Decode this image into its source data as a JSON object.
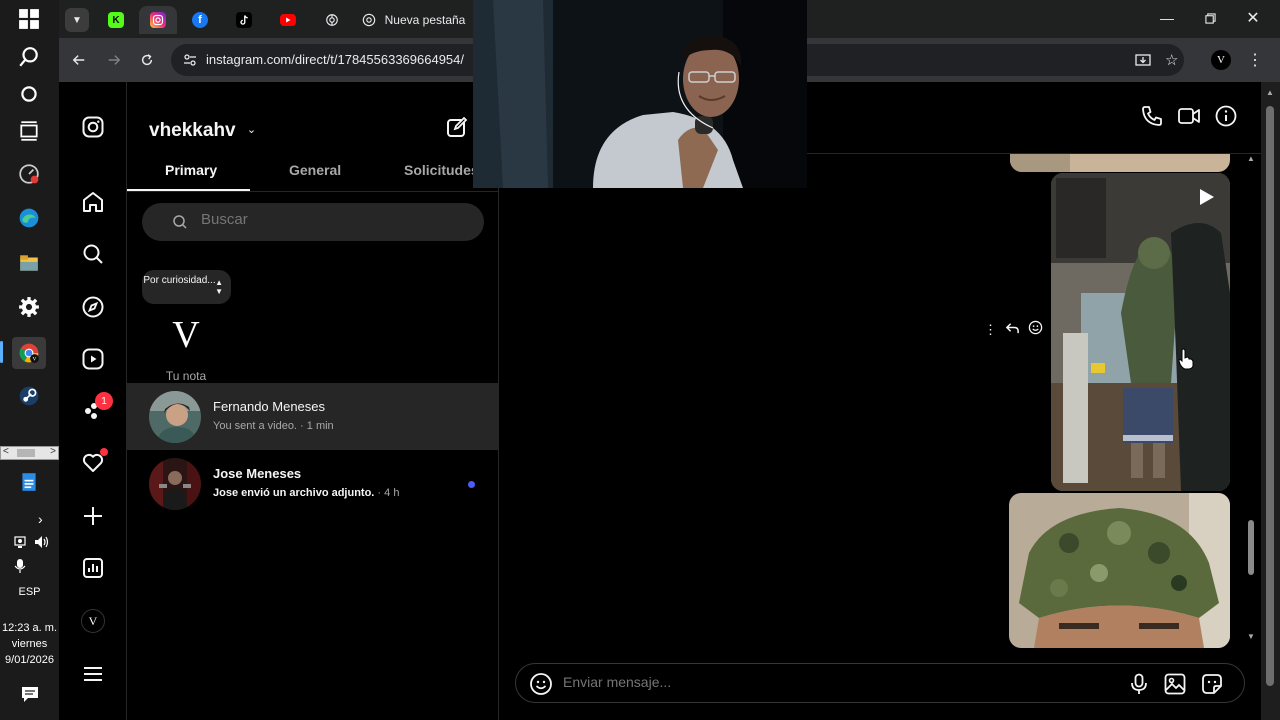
{
  "taskbar": {
    "time": "12:23 a. m.",
    "day": "viernes",
    "date": "9/01/2026",
    "language": "ESP"
  },
  "browser": {
    "tabs": [
      {
        "icon": "kick-icon"
      },
      {
        "icon": "instagram-icon",
        "active": true
      },
      {
        "icon": "facebook-icon"
      },
      {
        "icon": "tiktok-icon"
      },
      {
        "icon": "youtube-icon"
      },
      {
        "icon": "chatgpt-icon"
      },
      {
        "icon": "chrome-icon",
        "label": "Nueva pestaña"
      }
    ],
    "url": "instagram.com/direct/t/17845563369664954/",
    "profile_initial": "V"
  },
  "instagram": {
    "username": "vhekkahv",
    "tabs": {
      "primary": "Primary",
      "general": "General",
      "requests": "Solicitudes"
    },
    "search_placeholder": "Buscar",
    "note": {
      "text": "Por curiosidad...",
      "avatar_initial": "V",
      "label": "Tu nota"
    },
    "nav": {
      "notifications_badge": "1",
      "profile_initial": "V"
    },
    "threads": [
      {
        "name": "Fernando Meneses",
        "preview": "You sent a video. · 1 min",
        "active": true,
        "unread": false
      },
      {
        "name": "Jose Meneses",
        "preview_main": "Jose envió un archivo adjunto.",
        "preview_time": " · 4 h",
        "active": false,
        "unread": true
      }
    ],
    "composer_placeholder": "Enviar mensaje..."
  },
  "colors": {
    "background": "#000000",
    "panel": "#262626",
    "text_primary": "#f5f5f5",
    "text_secondary": "#a8a8a8",
    "unread": "#4a5df9",
    "badge": "#ff3040"
  }
}
